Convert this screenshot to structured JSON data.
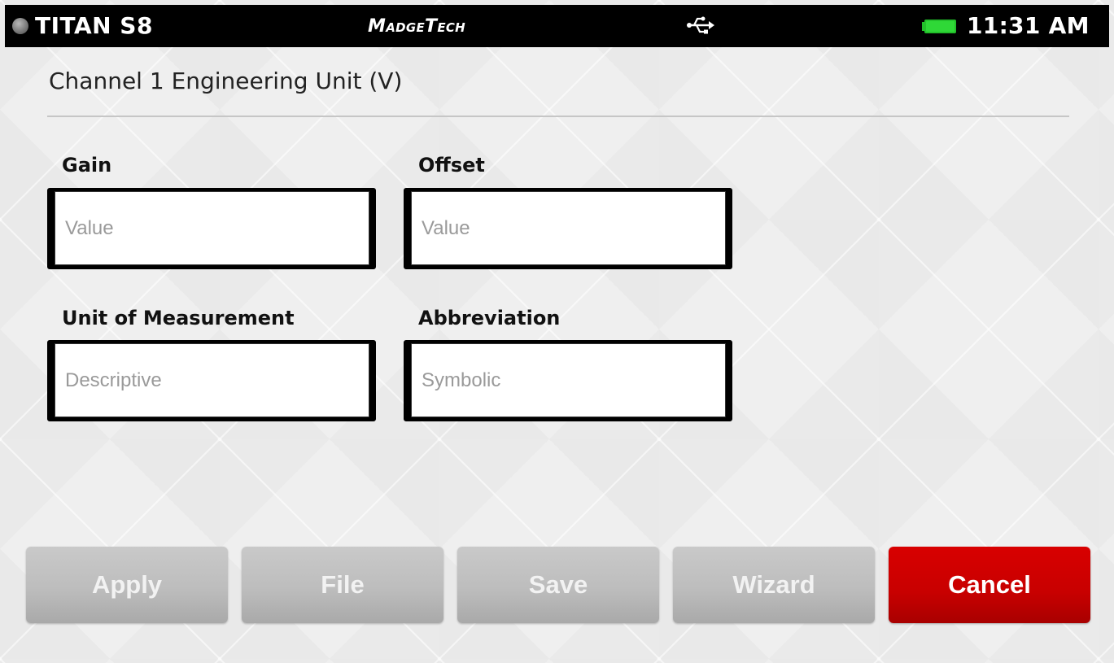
{
  "status_bar": {
    "device_name": "TITAN S8",
    "brand": "MadgeTech",
    "time": "11:31 AM",
    "usb_icon": "usb-icon",
    "battery_icon": "battery-icon",
    "battery_color": "#22c02a",
    "indicator_icon": "status-indicator-dot"
  },
  "page": {
    "title": "Channel 1 Engineering Unit (V)"
  },
  "fields": {
    "gain": {
      "label": "Gain",
      "value": "",
      "placeholder": "Value"
    },
    "offset": {
      "label": "Offset",
      "value": "",
      "placeholder": "Value"
    },
    "unit": {
      "label": "Unit of Measurement",
      "value": "",
      "placeholder": "Descriptive"
    },
    "abbreviation": {
      "label": "Abbreviation",
      "value": "",
      "placeholder": "Symbolic"
    }
  },
  "buttons": {
    "apply": "Apply",
    "file": "File",
    "save": "Save",
    "wizard": "Wizard",
    "cancel": "Cancel"
  },
  "colors": {
    "cancel": "#cc0000",
    "secondary_button": "#bdbdbd",
    "status_bar": "#000000"
  }
}
